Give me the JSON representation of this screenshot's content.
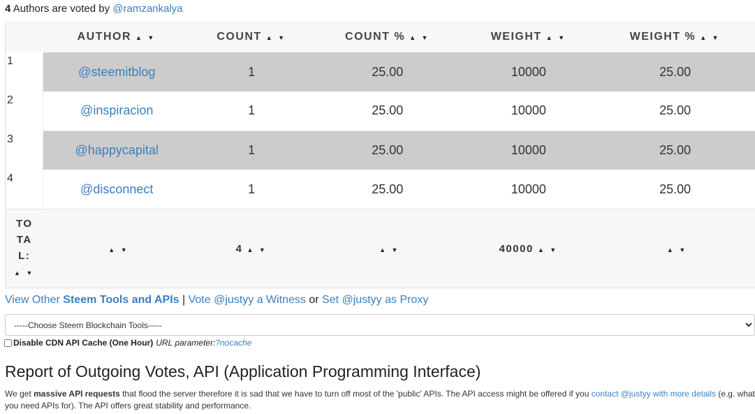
{
  "summary": {
    "count": "4",
    "text": " Authors are voted by ",
    "user": "@ramzankalya"
  },
  "table": {
    "headers": [
      "AUTHOR",
      "COUNT",
      "COUNT %",
      "WEIGHT",
      "WEIGHT %"
    ],
    "sort_glyph": "▲ ▼",
    "rows": [
      {
        "index": "1",
        "author": "@steemitblog",
        "count": "1",
        "count_pct": "25.00",
        "weight": "10000",
        "weight_pct": "25.00"
      },
      {
        "index": "2",
        "author": "@inspiracion",
        "count": "1",
        "count_pct": "25.00",
        "weight": "10000",
        "weight_pct": "25.00"
      },
      {
        "index": "3",
        "author": "@happycapital",
        "count": "1",
        "count_pct": "25.00",
        "weight": "10000",
        "weight_pct": "25.00"
      },
      {
        "index": "4",
        "author": "@disconnect",
        "count": "1",
        "count_pct": "25.00",
        "weight": "10000",
        "weight_pct": "25.00"
      }
    ],
    "total": {
      "label_lines": [
        "TO",
        "TA",
        "L:"
      ],
      "author": "",
      "count": "4",
      "count_pct": "",
      "weight": "40000",
      "weight_pct": ""
    }
  },
  "tools_line": {
    "view_other": "View Other ",
    "tools_bold": "Steem Tools and APIs",
    "sep": " | ",
    "vote": "Vote @justyy a Witness",
    "or": " or ",
    "proxy": "Set @justyy as Proxy"
  },
  "tools_select": {
    "selected": "-----Choose Steem Blockchain Tools-----"
  },
  "cdn": {
    "label": "Disable CDN API Cache (One Hour)",
    "param_label": "URL parameter: ",
    "param": "?nocache"
  },
  "report": {
    "title": "Report of Outgoing Votes, API (Application Programming Interface)",
    "p1": "We get ",
    "p_bold": "massive API requests",
    "p2": " that flood the server therefore it is sad that we have to turn off most of the 'public' APIs. The API access might be offered if you ",
    "p_link": "contact @justyy with more details",
    "p3": " (e.g. what you need APIs for). The API offers great stability and performance."
  },
  "colors": {
    "link": "#3a7fc0",
    "row_shade": "#cccccc",
    "header_bg": "#f7f7f7"
  }
}
